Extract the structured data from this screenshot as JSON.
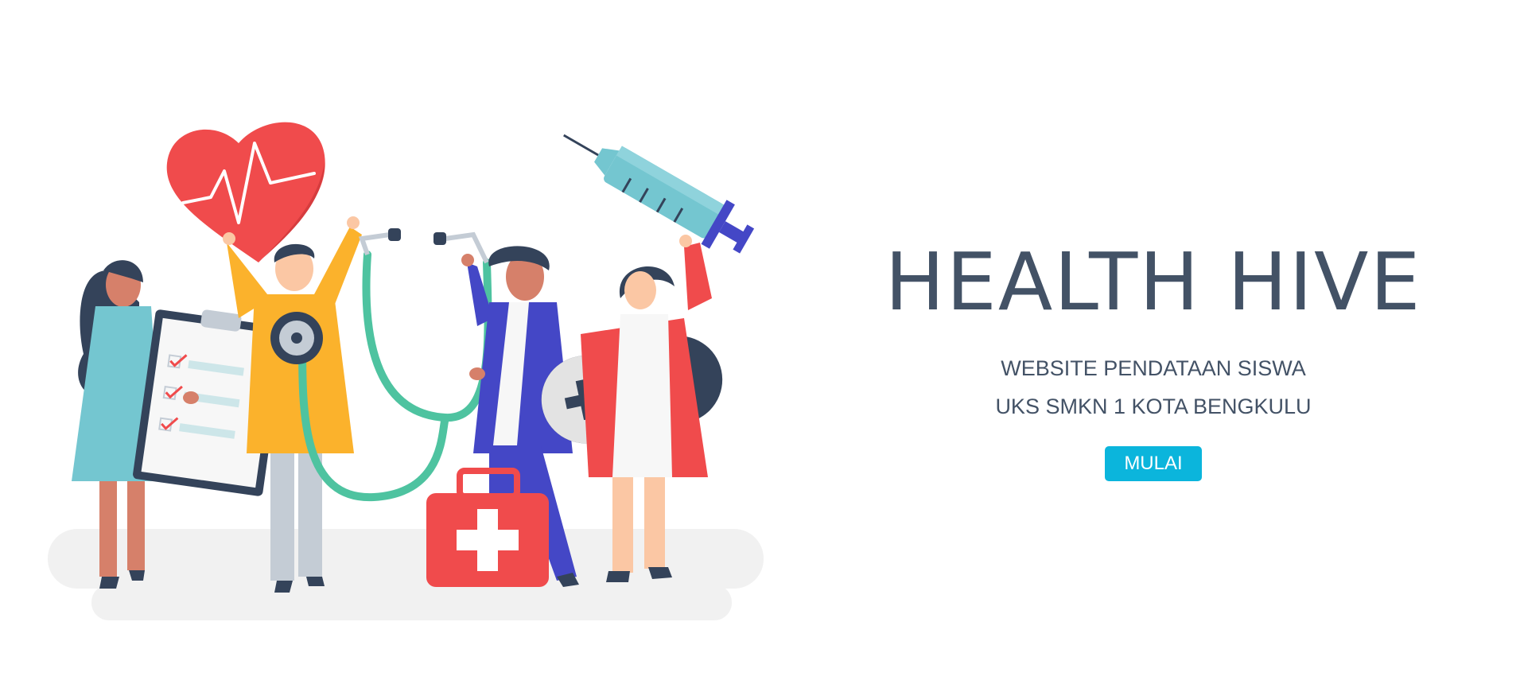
{
  "hero": {
    "title": "HEALTH HIVE",
    "subtitle_line1": "WEBSITE PENDATAAN SISWA",
    "subtitle_line2": "UKS SMKN 1 KOTA BENGKULU",
    "button_label": "MULAI"
  },
  "colors": {
    "accent": "#0bb5dc",
    "text": "#435266",
    "heart_red": "#f04b4c",
    "navy": "#34435a",
    "teal": "#74c6d0",
    "yellow": "#fbb22c",
    "blue": "#4447c6",
    "green": "#4ec3a0"
  },
  "illustration": {
    "icons": [
      "heart-pulse-icon",
      "syringe-icon",
      "stethoscope-icon",
      "clipboard-icon",
      "pill-capsule-icon",
      "first-aid-kit-icon"
    ]
  }
}
